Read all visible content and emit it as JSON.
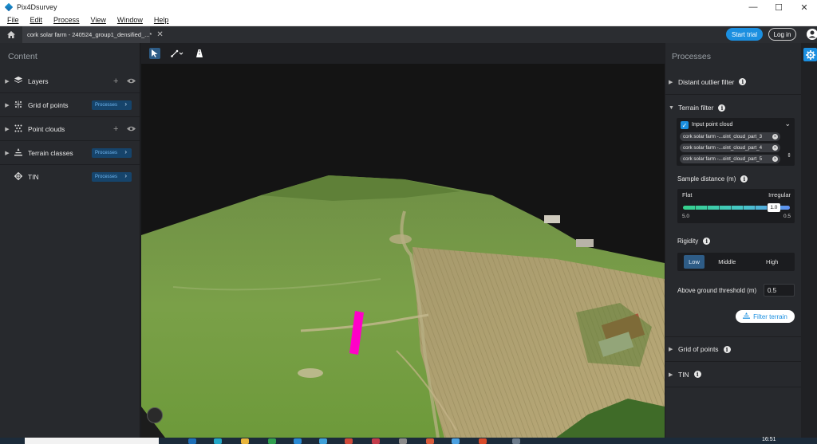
{
  "window": {
    "title": "Pix4Dsurvey",
    "controls": [
      "—",
      "☐",
      "✕"
    ]
  },
  "menu": [
    "File",
    "Edit",
    "Process",
    "View",
    "Window",
    "Help"
  ],
  "tab": {
    "label": "cork solar farm - 240524_group1_densified_...*",
    "close": "✕"
  },
  "header": {
    "start_trial": "Start trial",
    "login": "Log in"
  },
  "content_panel": {
    "title": "Content",
    "items": [
      {
        "label": "Layers",
        "icon": "layers-icon",
        "actions": [
          "add",
          "visibility"
        ]
      },
      {
        "label": "Grid of points",
        "icon": "grid-points-icon",
        "badge": "Processes"
      },
      {
        "label": "Point clouds",
        "icon": "point-cloud-icon",
        "actions": [
          "add",
          "visibility"
        ]
      },
      {
        "label": "Terrain classes",
        "icon": "terrain-icon",
        "badge": "Processes"
      },
      {
        "label": "TIN",
        "icon": "tin-icon",
        "badge": "Processes"
      }
    ]
  },
  "processes_panel": {
    "title": "Processes",
    "distant_outlier": {
      "label": "Distant outlier filter"
    },
    "terrain_filter": {
      "label": "Terrain filter",
      "input_label": "Input point cloud",
      "inputs": [
        "cork solar farm -...oint_cloud_part_3",
        "cork solar farm -...oint_cloud_part_4",
        "cork solar farm -...oint_cloud_part_5"
      ],
      "sample_distance_label": "Sample distance (m)",
      "slider": {
        "left_label": "Flat",
        "right_label": "Irregular",
        "value": "1.0",
        "min": "5.0",
        "max": "0.5",
        "fraction": 0.85
      },
      "rigidity_label": "Rigidity",
      "rigidity_options": [
        "Low",
        "Middle",
        "High"
      ],
      "rigidity_selected": "Low",
      "threshold_label": "Above ground threshold (m)",
      "threshold_value": "0.5",
      "button": "Filter terrain"
    },
    "grid_of_points": {
      "label": "Grid of points"
    },
    "tin": {
      "label": "TIN"
    }
  },
  "taskbar": {
    "time": "16:51"
  },
  "colors": {
    "accent": "#1b8fe0",
    "panel": "#27292d",
    "marker": "#ff00c8"
  }
}
